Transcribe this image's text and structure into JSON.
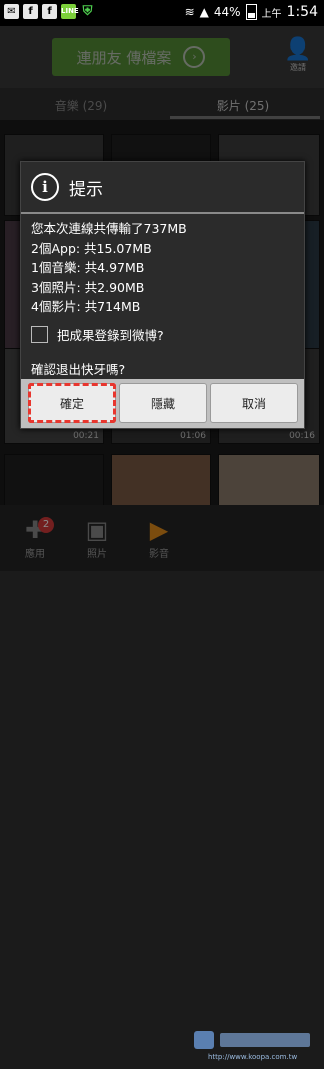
{
  "status_bar": {
    "left_icons": [
      "mail-icon",
      "facebook-icon",
      "facebook-icon",
      "line-icon",
      "shield-icon"
    ],
    "battery": "44%",
    "ampm": "上午",
    "time": "1:54"
  },
  "top_bar": {
    "share_button": "連朋友 傳檔案",
    "register_label": "邀請"
  },
  "tabs": [
    {
      "label": "音樂 (29)"
    },
    {
      "label": "影片 (25)"
    }
  ],
  "thumbnails": {
    "durations": [
      "00:21",
      "01:06",
      "00:16"
    ]
  },
  "bottom_nav": [
    {
      "label": "應用",
      "badge": "2"
    },
    {
      "label": "照片"
    },
    {
      "label": "影音"
    }
  ],
  "watermark": {
    "url": "http://www.koopa.com.tw"
  },
  "dialog": {
    "title": "提示",
    "lines": [
      "您本次連線共傳輸了737MB",
      "2個App: 共15.07MB",
      "1個音樂: 共4.97MB",
      "3個照片: 共2.90MB",
      "4個影片: 共714MB"
    ],
    "checkbox_label": "把成果登錄到微博?",
    "question": "確認退出快牙嗎?",
    "buttons": {
      "ok": "確定",
      "hide": "隱藏",
      "cancel": "取消"
    }
  },
  "colors": {
    "accent_green": "#5da935",
    "highlight_red": "#e8362e",
    "badge_red": "#d23a3a"
  }
}
